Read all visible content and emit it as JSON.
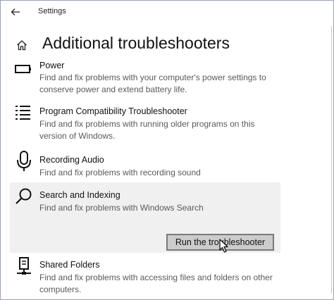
{
  "window": {
    "title": "Settings"
  },
  "page": {
    "title": "Additional troubleshooters"
  },
  "troubleshooters": [
    {
      "title": "Power",
      "description": "Find and fix problems with your computer's power settings to conserve power and extend battery life.",
      "icon": "battery-icon"
    },
    {
      "title": "Program Compatibility Troubleshooter",
      "description": "Find and fix problems with running older programs on this version of Windows.",
      "icon": "list-icon"
    },
    {
      "title": "Recording Audio",
      "description": "Find and fix problems with recording sound",
      "icon": "microphone-icon"
    },
    {
      "title": "Search and Indexing",
      "description": "Find and fix problems with Windows Search",
      "icon": "search-icon",
      "selected": true,
      "button_label": "Run the troubleshooter"
    },
    {
      "title": "Shared Folders",
      "description": "Find and fix problems with accessing files and folders on other computers.",
      "icon": "network-drive-icon"
    }
  ]
}
